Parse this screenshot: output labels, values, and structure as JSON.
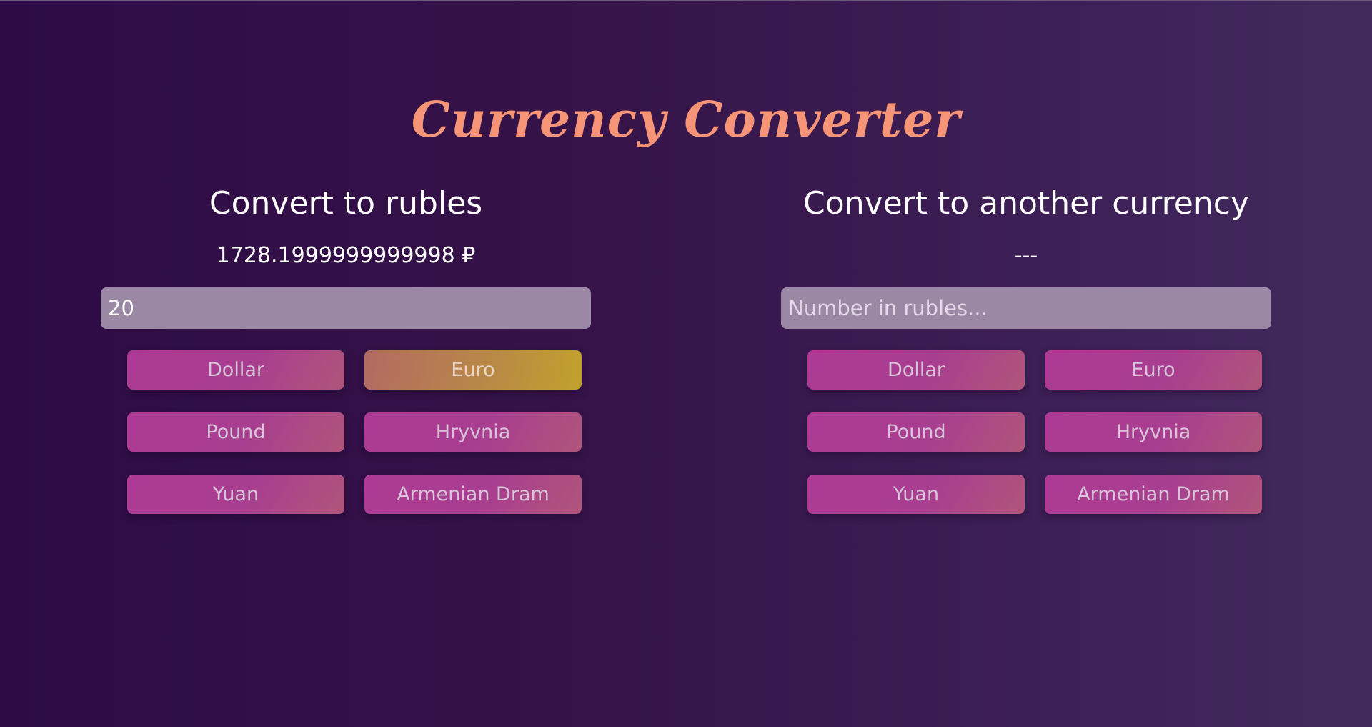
{
  "app": {
    "title": "Currency Converter"
  },
  "to_rubles": {
    "heading": "Convert to rubles",
    "result": "1728.1999999999998 ₽",
    "input_value": "20",
    "input_placeholder": "",
    "selected_currency": "Euro",
    "buttons": [
      "Dollar",
      "Euro",
      "Pound",
      "Hryvnia",
      "Yuan",
      "Armenian Dram"
    ]
  },
  "from_rubles": {
    "heading": "Convert to another currency",
    "result": "---",
    "input_value": "",
    "input_placeholder": "Number in rubles...",
    "buttons": [
      "Dollar",
      "Euro",
      "Pound",
      "Hryvnia",
      "Yuan",
      "Armenian Dram"
    ]
  },
  "colors": {
    "title": "#f59477",
    "button": "#ad3a94",
    "button_active": "#c2a12c",
    "input_bg": "#9b88a5"
  }
}
